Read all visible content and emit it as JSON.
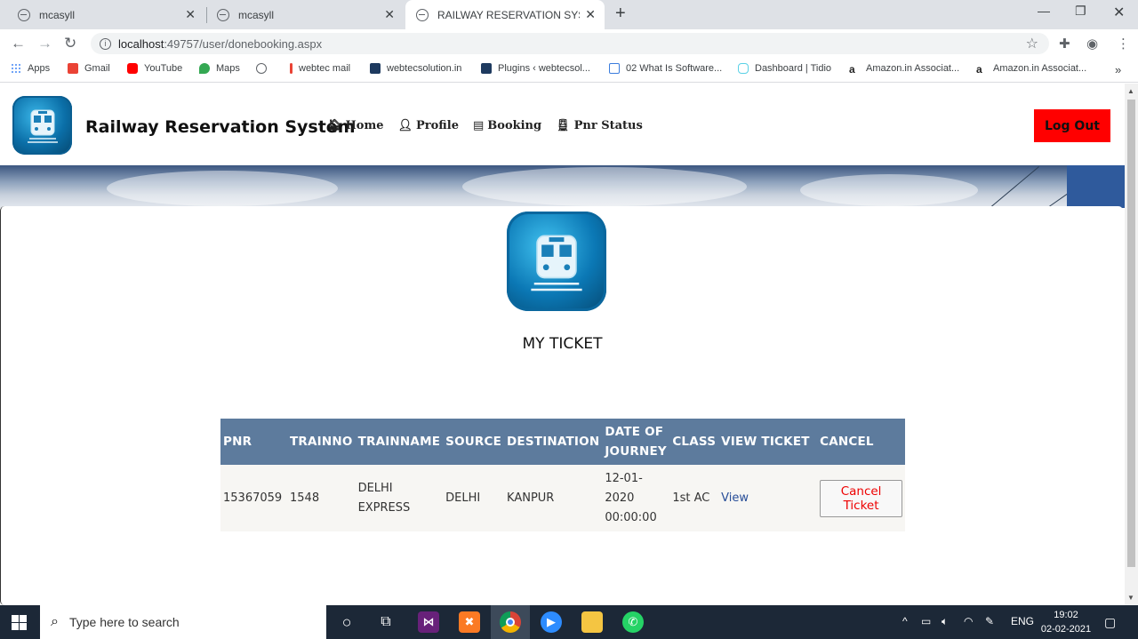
{
  "browser": {
    "tabs": [
      {
        "title": "mcasyll"
      },
      {
        "title": "mcasyll"
      },
      {
        "title": "RAILWAY RESERVATION SYSTEM"
      }
    ],
    "url_host": "localhost",
    "url_path": ":49757/user/donebooking.aspx",
    "bookmarks": [
      {
        "label": "Apps",
        "color": "#4285f4"
      },
      {
        "label": "Gmail",
        "color": "#ea4335"
      },
      {
        "label": "YouTube",
        "color": "#ff0000"
      },
      {
        "label": "Maps",
        "color": "#34a853"
      },
      {
        "label": "",
        "color": "#5f6368"
      },
      {
        "label": "webtec mail",
        "color": "#ea4335"
      },
      {
        "label": "webtecsolution.in",
        "color": "#1e3a5f"
      },
      {
        "label": "Plugins ‹ webtecsol...",
        "color": "#1e3a5f"
      },
      {
        "label": "02 What Is Software...",
        "color": "#3b7ddd"
      },
      {
        "label": "Dashboard | Tidio",
        "color": "#5ad1e6"
      },
      {
        "label": "Amazon.in Associat...",
        "color": "#222222"
      },
      {
        "label": "Amazon.in Associat...",
        "color": "#222222"
      }
    ]
  },
  "site": {
    "title": "Railway Reservation System",
    "nav": [
      {
        "label": "Home",
        "icon": "home-icon"
      },
      {
        "label": "Profile",
        "icon": "user-icon"
      },
      {
        "label": "Booking",
        "icon": "book-icon"
      },
      {
        "label": "Pnr Status",
        "icon": "train-icon"
      }
    ],
    "logout_label": "Log Out"
  },
  "main": {
    "heading": "MY TICKET",
    "table": {
      "headers": [
        "PNR",
        "TRAINNO",
        "TRAINNAME",
        "SOURCE",
        "DESTINATION",
        "DATE OF JOURNEY",
        "CLASS",
        "VIEW TICKET",
        "CANCEL"
      ],
      "rows": [
        {
          "pnr": "15367059",
          "trainno": "1548",
          "trainname": "DELHI EXPRESS",
          "source": "DELHI",
          "destination": "KANPUR",
          "date": "12-01-2020 00:00:00",
          "class": "1st AC",
          "view_label": "View",
          "cancel_label": "Cancel Ticket"
        }
      ]
    }
  },
  "taskbar": {
    "search_placeholder": "Type here to search",
    "language": "ENG",
    "time": "19:02",
    "date": "02-02-2021"
  },
  "colors": {
    "table_header": "#5d7b9d",
    "logout": "#ff0000",
    "cancel_text": "#ee0000",
    "link": "#284e98"
  }
}
